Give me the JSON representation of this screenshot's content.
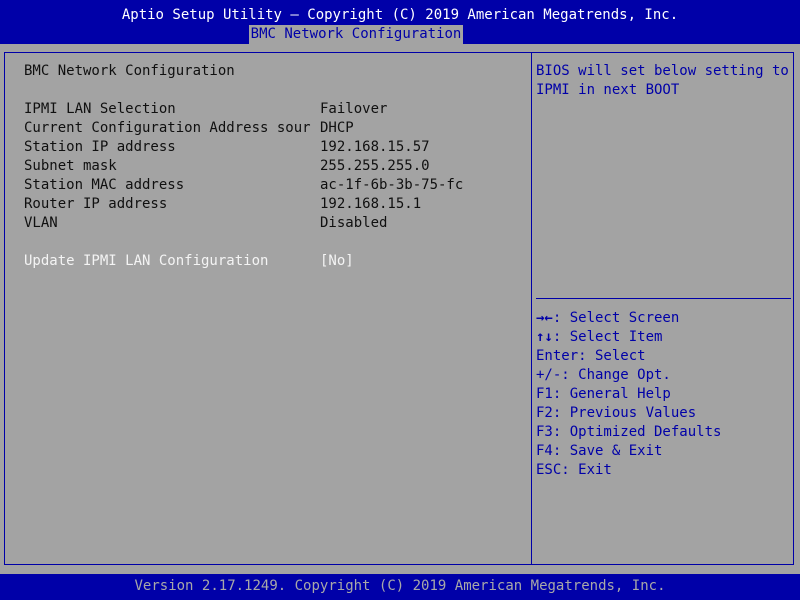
{
  "header": {
    "title": "Aptio Setup Utility – Copyright (C) 2019 American Megatrends, Inc.",
    "active_tab": "BMC Network Configuration"
  },
  "main": {
    "section_title": "BMC Network Configuration",
    "rows": [
      {
        "label": "IPMI LAN Selection",
        "value": "Failover"
      },
      {
        "label": "Current Configuration Address sour",
        "value": "DHCP"
      },
      {
        "label": "Station IP address",
        "value": "192.168.15.57"
      },
      {
        "label": "Subnet mask",
        "value": "255.255.255.0"
      },
      {
        "label": "Station MAC address",
        "value": "ac-1f-6b-3b-75-fc"
      },
      {
        "label": "Router IP address",
        "value": "192.168.15.1"
      },
      {
        "label": "VLAN",
        "value": "Disabled"
      }
    ],
    "update": {
      "label": "Update IPMI LAN Configuration",
      "value": "[No]"
    }
  },
  "help": {
    "line1": "BIOS will set below setting to",
    "line2": "IPMI in next BOOT"
  },
  "keys": [
    {
      "key": "→←",
      "desc": ": Select Screen"
    },
    {
      "key": "↑↓",
      "desc": ": Select Item"
    },
    {
      "key": "",
      "desc": "Enter: Select"
    },
    {
      "key": "",
      "desc": "+/-: Change Opt."
    },
    {
      "key": "",
      "desc": "F1: General Help"
    },
    {
      "key": "",
      "desc": "F2: Previous Values"
    },
    {
      "key": "",
      "desc": "F3: Optimized Defaults"
    },
    {
      "key": "",
      "desc": "F4: Save & Exit"
    },
    {
      "key": "",
      "desc": "ESC: Exit"
    }
  ],
  "footer": {
    "text": "Version 2.17.1249. Copyright (C) 2019 American Megatrends, Inc."
  },
  "colors": {
    "bios_blue": "#0000a8",
    "background_gray": "#a3a3a3",
    "highlight_white": "#f4f4f4"
  }
}
